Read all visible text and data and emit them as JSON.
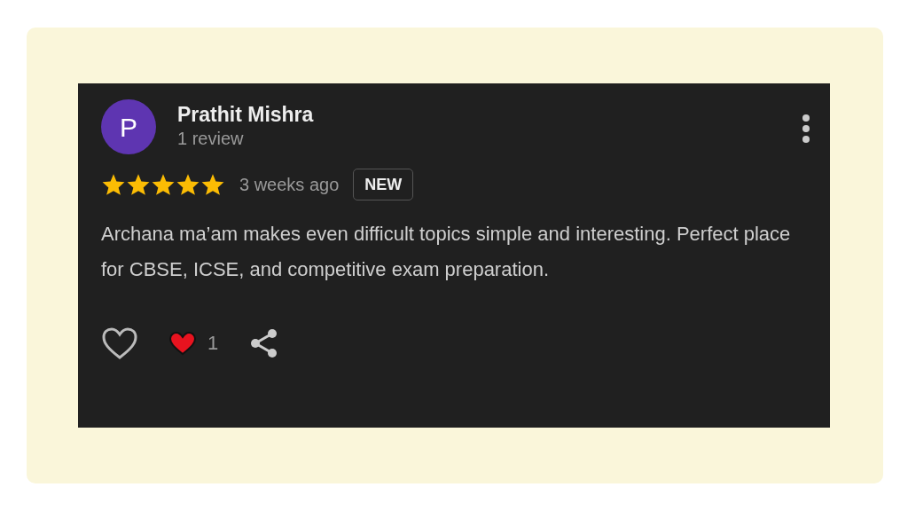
{
  "review": {
    "avatar_initial": "P",
    "author": "Prathit Mishra",
    "review_count": "1 review",
    "stars": 5,
    "time": "3 weeks ago",
    "badge": "NEW",
    "text": "Archana ma’am makes even difficult topics simple and interesting. Perfect place for CBSE, ICSE, and competitive exam preparation.",
    "liked": false,
    "reaction_count": "1"
  }
}
